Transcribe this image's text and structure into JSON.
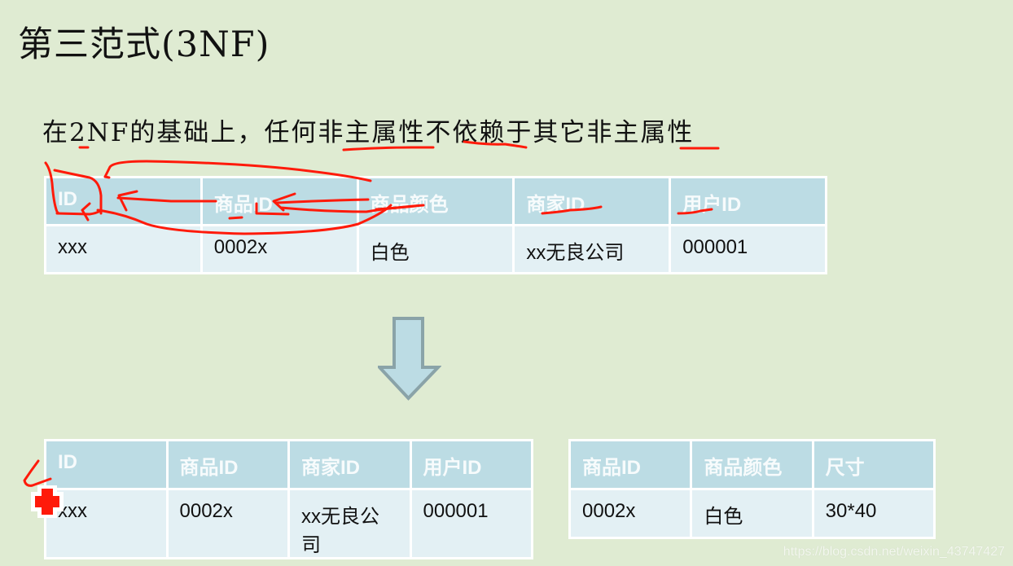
{
  "slide": {
    "title": "第三范式(3NF)",
    "subtitle": "在2NF的基础上，任何非主属性不依赖于其它非主属性"
  },
  "original_table": {
    "headers": [
      "ID",
      "商品ID",
      "商品颜色",
      "商家ID",
      "用户ID"
    ],
    "rows": [
      [
        "xxx",
        "0002x",
        "白色",
        "xx无良公司",
        "000001"
      ]
    ]
  },
  "arrow": {
    "icon": "down-arrow-icon",
    "fill": "#bcdce4",
    "stroke": "#8aa3a8"
  },
  "split_table_left": {
    "headers": [
      "ID",
      "商品ID",
      "商家ID",
      "用户ID"
    ],
    "rows": [
      [
        "xxx",
        "0002x",
        "xx无良公司",
        "000001"
      ]
    ]
  },
  "split_table_right": {
    "headers": [
      "商品ID",
      "商品颜色",
      "尺寸"
    ],
    "rows": [
      [
        "0002x",
        "白色",
        "30*40"
      ]
    ]
  },
  "annotation_color": "#ff1a0a",
  "watermark": "https://blog.csdn.net/weixin_43747427"
}
